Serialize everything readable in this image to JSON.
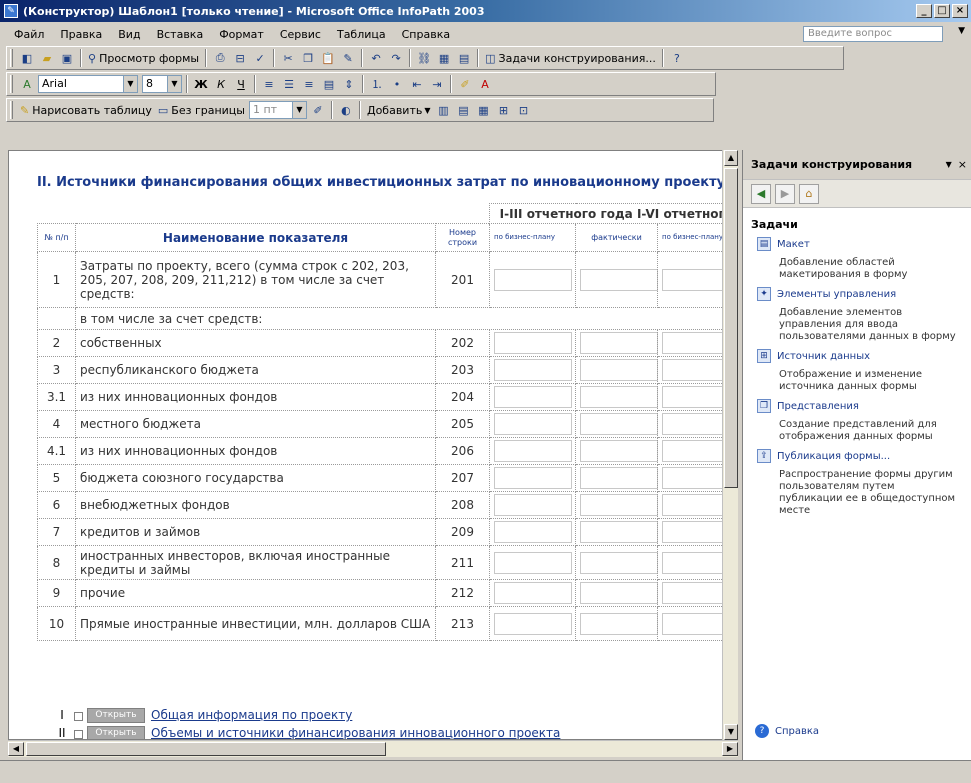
{
  "window": {
    "title": "(Конструктор) Шаблон1 [только чтение] - Microsoft Office InfoPath 2003",
    "min": "_",
    "max": "□",
    "close": "×"
  },
  "menu": {
    "items": [
      "Файл",
      "Правка",
      "Вид",
      "Вставка",
      "Формат",
      "Сервис",
      "Таблица",
      "Справка"
    ],
    "ask_placeholder": "Введите вопрос"
  },
  "toolbar1": {
    "preview_label": "Просмотр формы",
    "design_tasks_label": "Задачи конструирования..."
  },
  "toolbar2": {
    "font": "Arial",
    "size": "8",
    "bold": "Ж",
    "italic": "К",
    "underline": "Ч"
  },
  "toolbar3": {
    "draw_table": "Нарисовать таблицу",
    "no_border": "Без границы",
    "line_width": "1 пт",
    "add": "Добавить"
  },
  "form": {
    "section_title": "II. Источники финансирования общих инвестиционных затрат по инновационному проекту",
    "period1": "I-III отчетного года",
    "period2": "I-VI отчетного",
    "col_num": "№ п/п",
    "col_name": "Наименование показателя",
    "col_code": "Номер строки",
    "col_plan": "по бизнес-плану",
    "col_fact": "фактически",
    "col_plan2": "по бизнес-плану",
    "rows": [
      {
        "num": "1",
        "name": "Затраты по проекту, всего (сумма строк с 202, 203, 205, 207, 208, 209, 211,212) в том числе за счет средств:",
        "code": "201"
      },
      {
        "num": "",
        "name": "в том числе за счет средств:",
        "code": ""
      },
      {
        "num": "2",
        "name": "собственных",
        "code": "202"
      },
      {
        "num": "3",
        "name": "республиканского бюджета",
        "code": "203"
      },
      {
        "num": "3.1",
        "name": "из них инновационных фондов",
        "code": "204"
      },
      {
        "num": "4",
        "name": "местного бюджета",
        "code": "205"
      },
      {
        "num": "4.1",
        "name": "из них инновационных фондов",
        "code": "206"
      },
      {
        "num": "5",
        "name": "бюджета союзного государства",
        "code": "207"
      },
      {
        "num": "6",
        "name": "внебюджетных фондов",
        "code": "208"
      },
      {
        "num": "7",
        "name": "кредитов и займов",
        "code": "209"
      },
      {
        "num": "8",
        "name": "иностранных инвесторов, включая иностранные кредиты и займы",
        "code": "211"
      },
      {
        "num": "9",
        "name": "прочие",
        "code": "212"
      },
      {
        "num": "10",
        "name": "Прямые иностранные инвестиции, млн. долларов США",
        "code": "213"
      }
    ],
    "sections": [
      {
        "num": "I",
        "button": "Открыть",
        "label": "Общая информация по проекту"
      },
      {
        "num": "II",
        "button": "Открыть",
        "label": "Объемы и источники финансирования инновационного проекта"
      }
    ]
  },
  "taskpane": {
    "title": "Задачи конструирования",
    "close": "×",
    "section": "Задачи",
    "items": [
      {
        "link": "Макет",
        "desc": "Добавление областей макетирования в форму"
      },
      {
        "link": "Элементы управления",
        "desc": "Добавление элементов управления для ввода пользователями данных в форму"
      },
      {
        "link": "Источник данных",
        "desc": "Отображение и изменение источника данных формы"
      },
      {
        "link": "Представления",
        "desc": "Создание представлений для отображения данных формы"
      },
      {
        "link": "Публикация формы...",
        "desc": "Распространение формы другим пользователям путем публикации ее в общедоступном месте"
      }
    ],
    "help": "Справка"
  }
}
